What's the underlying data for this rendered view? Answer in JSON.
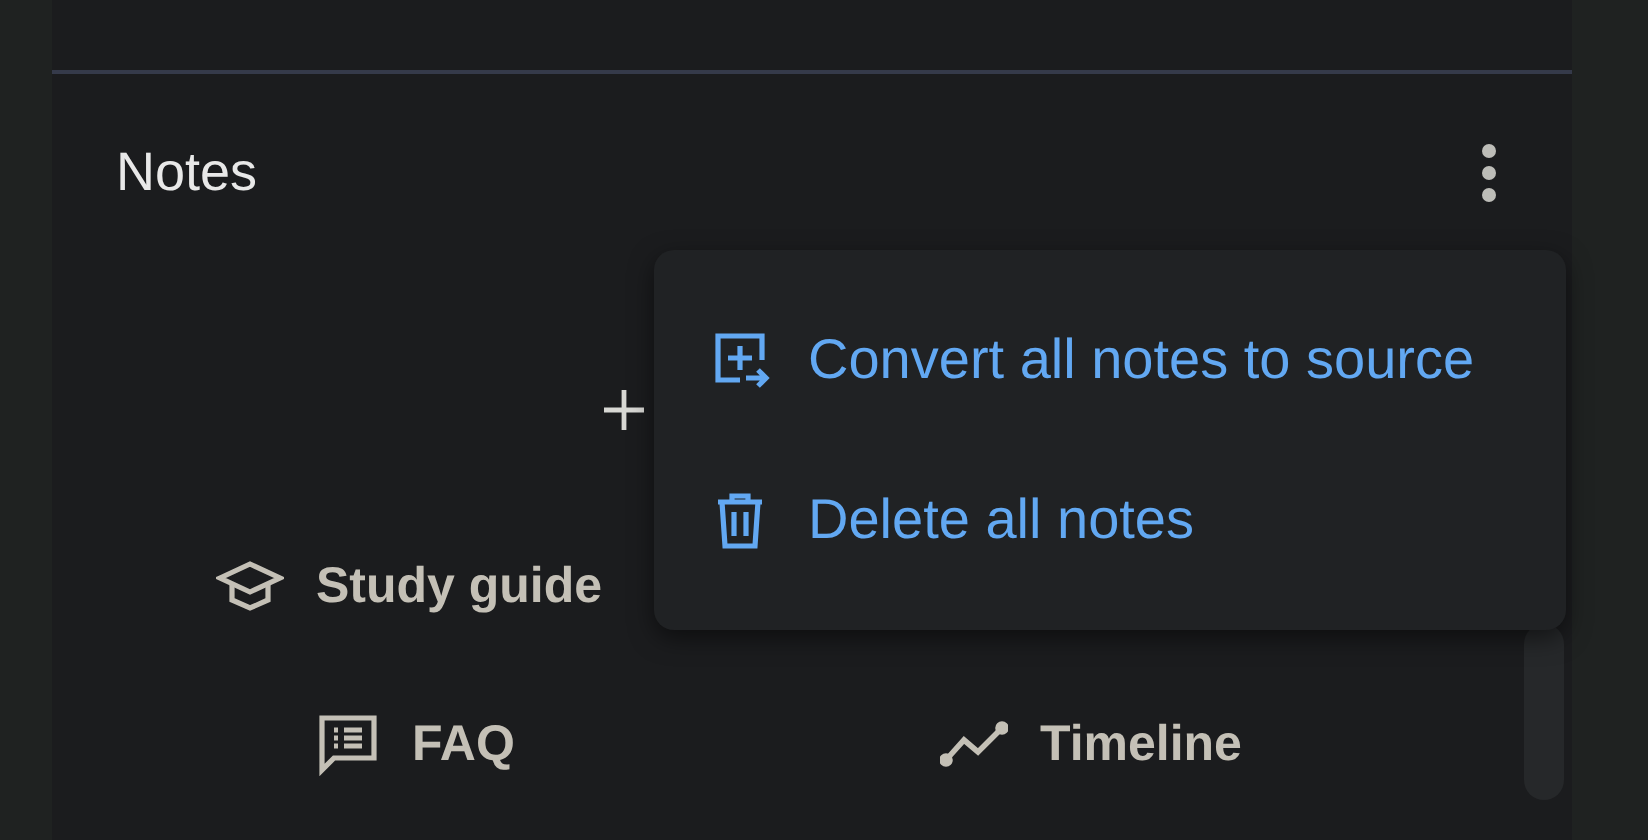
{
  "notes_panel": {
    "title": "Notes"
  },
  "menu": {
    "items": [
      {
        "kind": "convert",
        "label": "Convert all notes to source"
      },
      {
        "kind": "delete",
        "label": "Delete all notes"
      }
    ]
  },
  "note_buttons": [
    {
      "kind": "study",
      "label": "Study guide"
    },
    {
      "kind": "faq",
      "label": "FAQ"
    },
    {
      "kind": "timeline",
      "label": "Timeline"
    }
  ]
}
